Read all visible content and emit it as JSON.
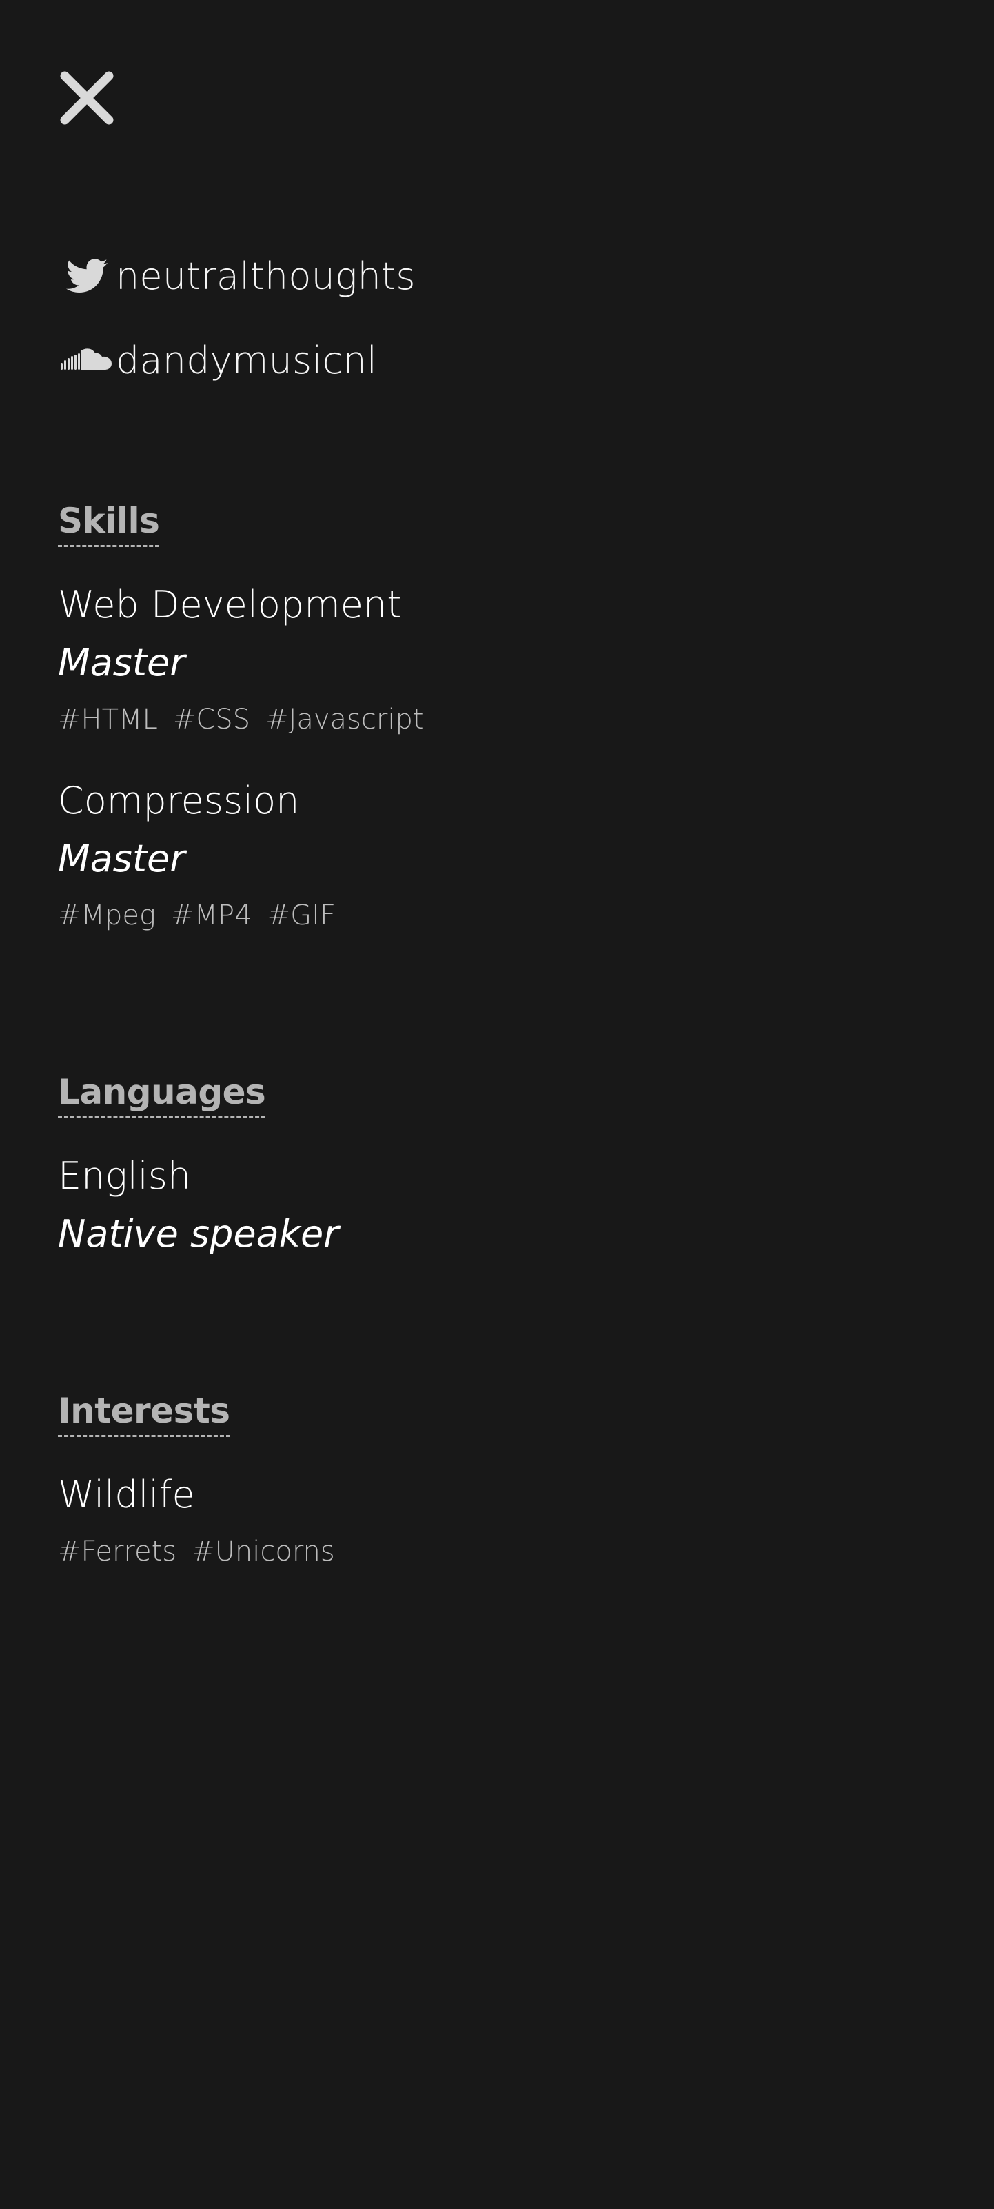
{
  "close": {
    "icon": "close-icon"
  },
  "social": [
    {
      "icon": "twitter-icon",
      "label": "neutralthoughts"
    },
    {
      "icon": "soundcloud-icon",
      "label": "dandymusicnl"
    }
  ],
  "skills": {
    "heading": "Skills",
    "entries": [
      {
        "title": "Web Development",
        "level": "Master",
        "tags": [
          "#HTML",
          "#CSS",
          "#Javascript"
        ]
      },
      {
        "title": "Compression",
        "level": "Master",
        "tags": [
          "#Mpeg",
          "#MP4",
          "#GIF"
        ]
      }
    ]
  },
  "languages": {
    "heading": "Languages",
    "entries": [
      {
        "title": "English",
        "level": "Native speaker"
      }
    ]
  },
  "interests": {
    "heading": "Interests",
    "entries": [
      {
        "title": "Wildlife",
        "tags": [
          "#Ferrets",
          "#Unicorns"
        ]
      }
    ]
  },
  "colors": {
    "background": "#181818",
    "heading": "#b4b4b4",
    "text": "#ffffff",
    "tag": "#bdbdbd"
  }
}
